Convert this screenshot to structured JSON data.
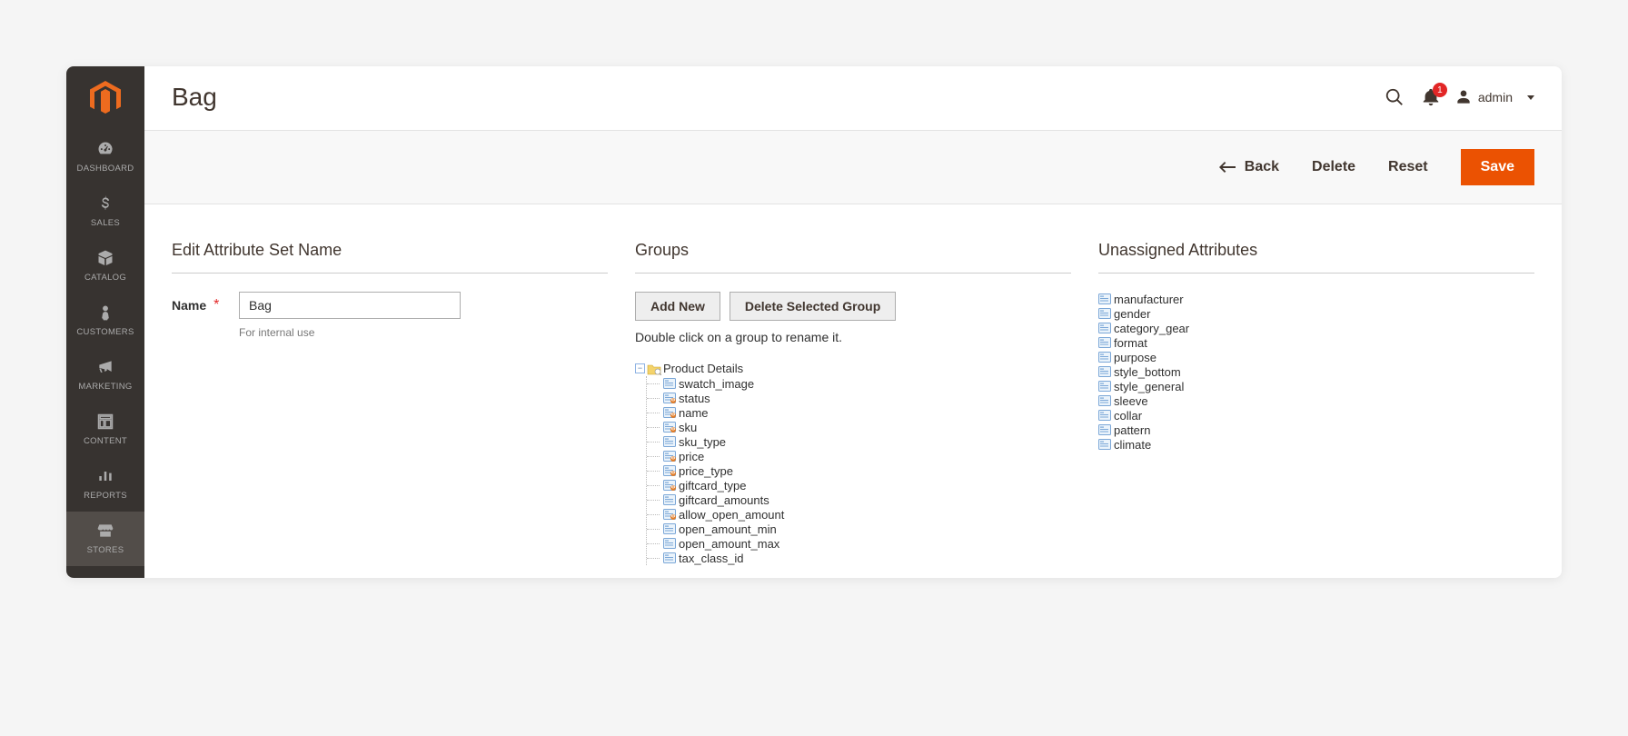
{
  "sidebar": {
    "items": [
      {
        "label": "DASHBOARD"
      },
      {
        "label": "SALES"
      },
      {
        "label": "CATALOG"
      },
      {
        "label": "CUSTOMERS"
      },
      {
        "label": "MARKETING"
      },
      {
        "label": "CONTENT"
      },
      {
        "label": "REPORTS"
      },
      {
        "label": "STORES"
      }
    ]
  },
  "header": {
    "title": "Bag",
    "notification_count": "1",
    "user_name": "admin"
  },
  "actions": {
    "back": "Back",
    "delete": "Delete",
    "reset": "Reset",
    "save": "Save"
  },
  "edit_section": {
    "title": "Edit Attribute Set Name",
    "name_label": "Name",
    "name_value": "Bag",
    "name_help": "For internal use"
  },
  "groups_section": {
    "title": "Groups",
    "add_new": "Add New",
    "delete_group": "Delete Selected Group",
    "hint": "Double click on a group to rename it.",
    "group_name": "Product Details",
    "attributes": [
      {
        "name": "swatch_image",
        "locked": false
      },
      {
        "name": "status",
        "locked": true
      },
      {
        "name": "name",
        "locked": true
      },
      {
        "name": "sku",
        "locked": true
      },
      {
        "name": "sku_type",
        "locked": false
      },
      {
        "name": "price",
        "locked": true
      },
      {
        "name": "price_type",
        "locked": true
      },
      {
        "name": "giftcard_type",
        "locked": true
      },
      {
        "name": "giftcard_amounts",
        "locked": false
      },
      {
        "name": "allow_open_amount",
        "locked": true
      },
      {
        "name": "open_amount_min",
        "locked": false
      },
      {
        "name": "open_amount_max",
        "locked": false
      },
      {
        "name": "tax_class_id",
        "locked": false
      }
    ]
  },
  "unassigned_section": {
    "title": "Unassigned Attributes",
    "attributes": [
      "manufacturer",
      "gender",
      "category_gear",
      "format",
      "purpose",
      "style_bottom",
      "style_general",
      "sleeve",
      "collar",
      "pattern",
      "climate"
    ]
  }
}
